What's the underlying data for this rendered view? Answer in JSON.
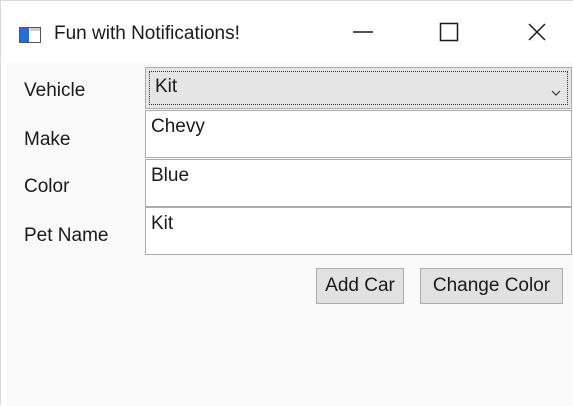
{
  "window": {
    "title": "Fun with Notifications!"
  },
  "form": {
    "vehicle": {
      "label": "Vehicle",
      "selected": "Kit"
    },
    "make": {
      "label": "Make",
      "value": "Chevy"
    },
    "color": {
      "label": "Color",
      "value": "Blue"
    },
    "pet_name": {
      "label": "Pet Name",
      "value": "Kit"
    }
  },
  "buttons": {
    "add_car": "Add Car",
    "change_color": "Change Color"
  },
  "icons": {
    "app": "app-window-icon",
    "minimize": "minimize-icon",
    "maximize": "maximize-icon",
    "close": "close-icon",
    "dropdown": "chevron-down-icon"
  },
  "colors": {
    "client_bg": "#f9f9f9",
    "control_border": "#adadad",
    "button_bg": "#e1e1e1",
    "app_icon_accent": "#2b6bd6"
  }
}
